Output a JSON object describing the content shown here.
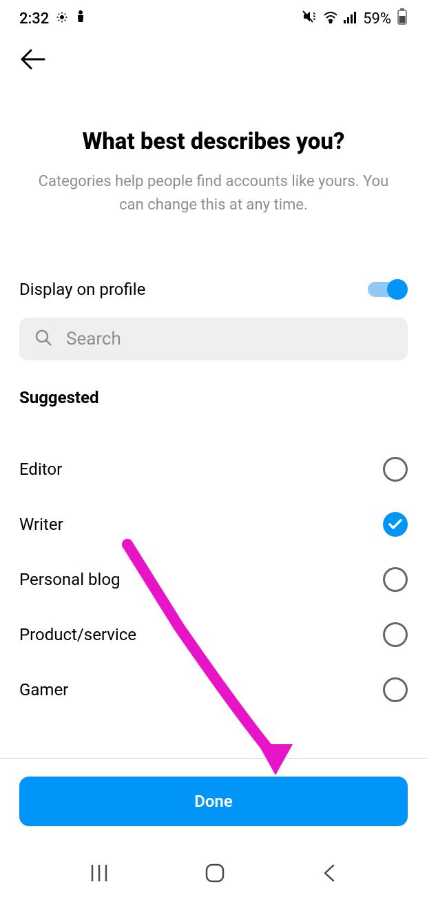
{
  "status": {
    "time": "2:32",
    "battery_percent": "59%"
  },
  "header": {
    "title": "What best describes you?",
    "subtitle": "Categories help people find accounts like yours. You can change this at any time."
  },
  "display_toggle": {
    "label": "Display on profile",
    "enabled": true
  },
  "search": {
    "placeholder": "Search"
  },
  "section_header": "Suggested",
  "categories": [
    {
      "label": "Editor",
      "selected": false
    },
    {
      "label": "Writer",
      "selected": true
    },
    {
      "label": "Personal blog",
      "selected": false
    },
    {
      "label": "Product/service",
      "selected": false
    },
    {
      "label": "Gamer",
      "selected": false
    }
  ],
  "footer": {
    "done_label": "Done"
  },
  "colors": {
    "accent": "#0095f6",
    "annotation": "#e815c8"
  }
}
